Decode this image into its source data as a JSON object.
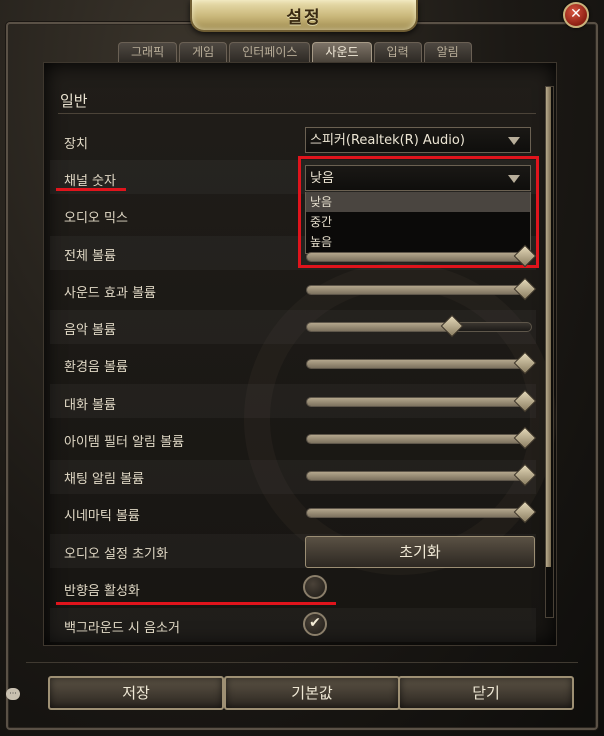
{
  "window": {
    "title": "설정",
    "close_symbol": "✕"
  },
  "tabs": [
    {
      "label": "그래픽",
      "active": false
    },
    {
      "label": "게임",
      "active": false
    },
    {
      "label": "인터페이스",
      "active": false
    },
    {
      "label": "사운드",
      "active": true
    },
    {
      "label": "입력",
      "active": false
    },
    {
      "label": "알림",
      "active": false
    }
  ],
  "section": {
    "title": "일반"
  },
  "rows": {
    "device": {
      "label": "장치",
      "value": "스피커(Realtek(R) Audio)"
    },
    "channel": {
      "label": "채널 숫자",
      "value": "낮음"
    },
    "audio_mix": {
      "label": "오디오 믹스"
    },
    "master": {
      "label": "전체 볼륨",
      "level": 1.0
    },
    "sfx": {
      "label": "사운드 효과 볼륨",
      "level": 1.0
    },
    "music": {
      "label": "음악 볼륨",
      "level": 0.65
    },
    "ambient": {
      "label": "환경음 볼륨",
      "level": 1.0
    },
    "dialogue": {
      "label": "대화 볼륨",
      "level": 1.0
    },
    "item_filter": {
      "label": "아이템 필터 알림 볼륨",
      "level": 1.0
    },
    "chat": {
      "label": "채팅 알림 볼륨",
      "level": 1.0
    },
    "cinematic": {
      "label": "시네마틱 볼륨",
      "level": 1.0
    },
    "reset_audio": {
      "label": "오디오 설정 초기화",
      "button": "초기화"
    },
    "reverb": {
      "label": "반향음 활성화",
      "checked": false
    },
    "mute_bg": {
      "label": "백그라운드 시 음소거",
      "checked": true
    }
  },
  "dropdown_options": [
    "낮음",
    "중간",
    "높음"
  ],
  "buttons": {
    "save": "저장",
    "default": "기본값",
    "close": "닫기"
  },
  "colors": {
    "highlight": "#e0141c",
    "gold": "#c9b77a"
  }
}
